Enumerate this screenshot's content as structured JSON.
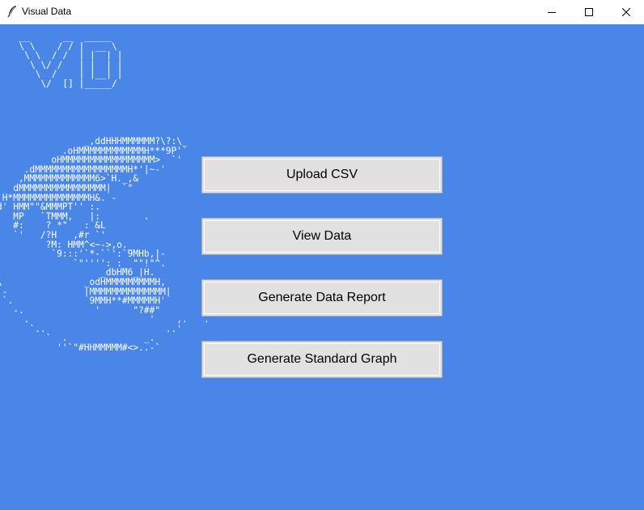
{
  "window": {
    "title": "Visual Data",
    "controls": {
      "minimize": "minimize-icon",
      "maximize": "maximize-icon",
      "close": "close-icon"
    }
  },
  "logo_art": "  __      __  _____\n  \\ \\    / / |  __ \\\n   \\ \\  / /  | |  | |\n    \\ \\/ /   | |  | |\n     \\  /    | |__| |\n      \\/  [] |_____/",
  "emblem_art": "                _,ddHHHMMMMMM?\\?:\\_\n            .oHMMMMMMMMMMMMH***9P'`\n          oHMMMMMMMMMMMMMMMMM>  `'\n     .dMMMMMMMMMMMMMMMMMH*'|~-'\n    ,MMMMMMMMMMMMM6>`H._,&\n   dMMMMMMMMMMMMMMMM|  `\"\n H*MMMMMMMMMMMMMMH&. -\nd' HMM\"\"&MMMPT'' :.\n'  MP   `TMMM,   |:        .\n   #:    ? *\"   : &L\n   `'   /?H   ,#r `'\n         ?M: HMM^<~->,o._\n          `9:::'`*-``':`9MHb,|-\n              `\"'''': :_ \"\"!\"^.\n.                  _dbHM6_|H.\n\\               _odHMMMMMMMMMH,\n`-              |MMMMMMMMMMMMMM|\n `.              9MMH**#MMMMMH'\n   -.             '      \"?##\"\n     .                      '    ,.   .\n      `..                      ..'\n         `  .              _.\n           ''`\"#HHMMMMM#<>..-`",
  "buttons": {
    "upload_csv": "Upload CSV",
    "view_data": "View Data",
    "generate_report": "Generate Data Report",
    "generate_graph": "Generate Standard Graph"
  },
  "colors": {
    "background": "#4a86e8",
    "button_face": "#e1e1e1",
    "button_border": "#adadad",
    "art_text": "#ffffff"
  }
}
